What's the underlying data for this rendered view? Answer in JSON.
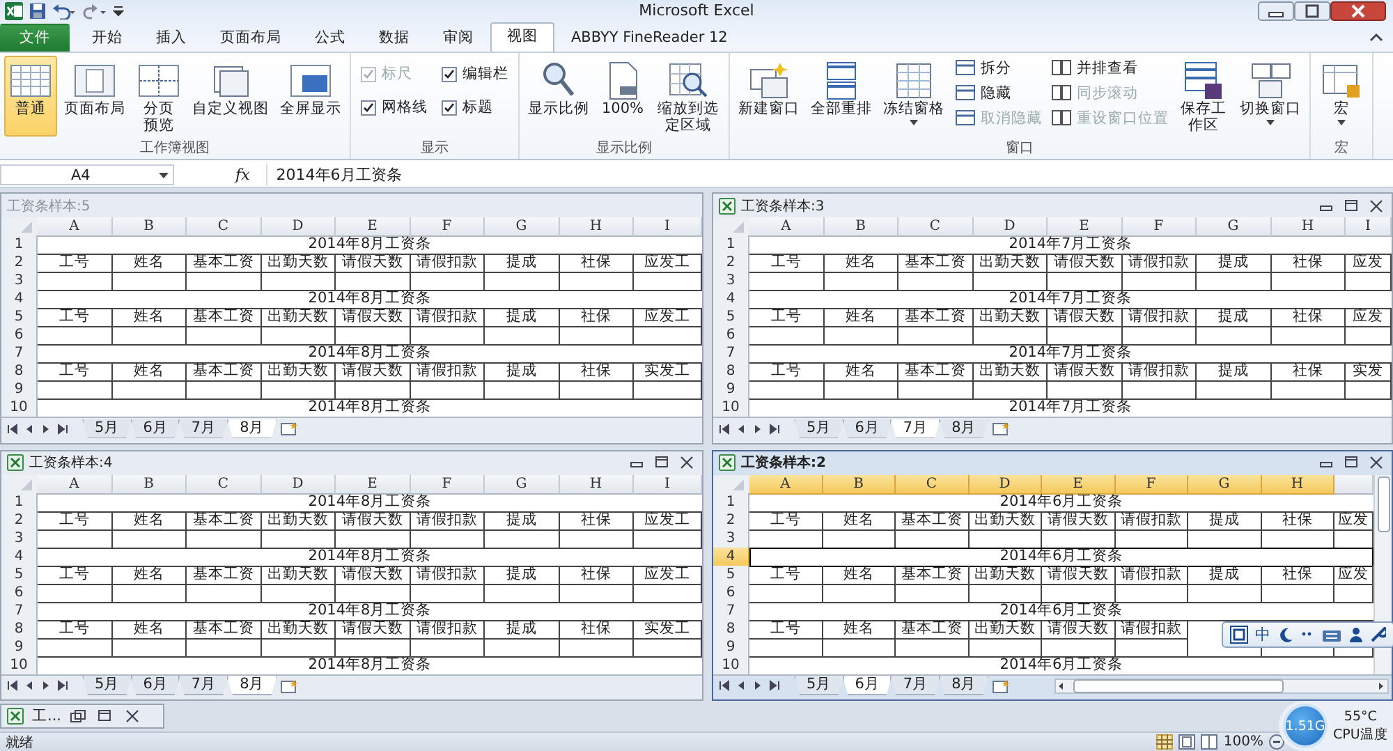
{
  "title_bar": {
    "title": "Microsoft Excel"
  },
  "tabs": [
    {
      "label": "文件",
      "kind": "file",
      "selected": false
    },
    {
      "label": "开始",
      "kind": "tab",
      "selected": false
    },
    {
      "label": "插入",
      "kind": "tab",
      "selected": false
    },
    {
      "label": "页面布局",
      "kind": "tab",
      "selected": false
    },
    {
      "label": "公式",
      "kind": "tab",
      "selected": false
    },
    {
      "label": "数据",
      "kind": "tab",
      "selected": false
    },
    {
      "label": "审阅",
      "kind": "tab",
      "selected": false
    },
    {
      "label": "视图",
      "kind": "tab",
      "selected": true
    },
    {
      "label": "ABBYY FineReader 12",
      "kind": "tab",
      "selected": false
    }
  ],
  "ribbon": {
    "groups": [
      {
        "label": "工作簿视图",
        "items": [
          {
            "kind": "large",
            "label": "普通",
            "selected": true
          },
          {
            "kind": "large",
            "label": "页面布局",
            "selected": false
          },
          {
            "kind": "large",
            "label": "分页预览",
            "wrap": true,
            "selected": false
          },
          {
            "kind": "large",
            "label": "自定义视图",
            "selected": false
          },
          {
            "kind": "large",
            "label": "全屏显示",
            "selected": false
          }
        ]
      },
      {
        "label": "显示",
        "items": [
          {
            "kind": "checkbox",
            "label": "标尺",
            "checked": true,
            "disabled": true
          },
          {
            "kind": "checkbox",
            "label": "编辑栏",
            "checked": true,
            "disabled": false
          },
          {
            "kind": "checkbox",
            "label": "网格线",
            "checked": true,
            "disabled": false
          },
          {
            "kind": "checkbox",
            "label": "标题",
            "checked": true,
            "disabled": false
          }
        ]
      },
      {
        "label": "显示比例",
        "items": [
          {
            "kind": "large",
            "label": "显示比例"
          },
          {
            "kind": "large",
            "label": "100%"
          },
          {
            "kind": "large",
            "label": "缩放到选定区域",
            "wrap": true
          }
        ]
      },
      {
        "label": "窗口",
        "items": [
          {
            "kind": "large",
            "label": "新建窗口"
          },
          {
            "kind": "large",
            "label": "全部重排"
          },
          {
            "kind": "large",
            "label": "冻结窗格",
            "dropdown": true
          },
          {
            "kind": "small",
            "label": "拆分",
            "disabled": false
          },
          {
            "kind": "small",
            "label": "隐藏",
            "disabled": false
          },
          {
            "kind": "small",
            "label": "取消隐藏",
            "disabled": true
          },
          {
            "kind": "small",
            "label": "并排查看",
            "disabled": false
          },
          {
            "kind": "small",
            "label": "同步滚动",
            "disabled": true
          },
          {
            "kind": "small",
            "label": "重设窗口位置",
            "disabled": true
          },
          {
            "kind": "large",
            "label": "保存工作区",
            "wrap": true
          },
          {
            "kind": "large",
            "label": "切换窗口",
            "dropdown": true
          }
        ]
      },
      {
        "label": "宏",
        "items": [
          {
            "kind": "large",
            "label": "宏",
            "dropdown": true
          }
        ]
      }
    ]
  },
  "formula_bar": {
    "cell": "A4",
    "function_symbol": "fx",
    "content": "2014年6月工资条"
  },
  "windows": [
    {
      "title": "工资条样本:5",
      "controls": false,
      "active": false,
      "columns": [
        {
          "label": "A",
          "selected": false
        },
        {
          "label": "B",
          "selected": false
        },
        {
          "label": "C",
          "selected": false
        },
        {
          "label": "D",
          "selected": false
        },
        {
          "label": "E",
          "selected": false
        },
        {
          "label": "F",
          "selected": false
        },
        {
          "label": "G",
          "selected": false
        },
        {
          "label": "H",
          "selected": false
        },
        {
          "label": "I",
          "selected": false
        }
      ],
      "rows": [
        {
          "number": "1",
          "kind": "title",
          "text": "2014年8月工资条",
          "selected": false
        },
        {
          "number": "2",
          "kind": "header",
          "cells": [
            "工号",
            "姓名",
            "基本工资",
            "出勤天数",
            "请假天数",
            "请假扣款",
            "提成",
            "社保",
            "应发工"
          ],
          "selected": false
        },
        {
          "number": "3",
          "kind": "blank",
          "selected": false
        },
        {
          "number": "4",
          "kind": "title",
          "text": "2014年8月工资条",
          "selected": false
        },
        {
          "number": "5",
          "kind": "header",
          "cells": [
            "工号",
            "姓名",
            "基本工资",
            "出勤天数",
            "请假天数",
            "请假扣款",
            "提成",
            "社保",
            "应发工"
          ],
          "selected": false
        },
        {
          "number": "6",
          "kind": "blank",
          "selected": false
        },
        {
          "number": "7",
          "kind": "title",
          "text": "2014年8月工资条",
          "selected": false
        },
        {
          "number": "8",
          "kind": "header",
          "cells": [
            "工号",
            "姓名",
            "基本工资",
            "出勤天数",
            "请假天数",
            "请假扣款",
            "提成",
            "社保",
            "实发工"
          ],
          "selected": false
        },
        {
          "number": "9",
          "kind": "blank",
          "selected": false
        },
        {
          "number": "10",
          "kind": "title",
          "text": "2014年8月工资条",
          "selected": false
        }
      ],
      "sheets": [
        {
          "label": "5月",
          "selected": false
        },
        {
          "label": "6月",
          "selected": false
        },
        {
          "label": "7月",
          "selected": false
        },
        {
          "label": "8月",
          "selected": true
        }
      ]
    },
    {
      "title": "工资条样本:3",
      "controls": true,
      "active": false,
      "columns": [
        {
          "label": "A",
          "selected": false
        },
        {
          "label": "B",
          "selected": false
        },
        {
          "label": "C",
          "selected": false
        },
        {
          "label": "D",
          "selected": false
        },
        {
          "label": "E",
          "selected": false
        },
        {
          "label": "F",
          "selected": false
        },
        {
          "label": "G",
          "selected": false
        },
        {
          "label": "H",
          "selected": false
        },
        {
          "label": "I",
          "selected": false
        }
      ],
      "rows": [
        {
          "number": "1",
          "kind": "title",
          "text": "2014年7月工资条",
          "selected": false
        },
        {
          "number": "2",
          "kind": "header",
          "cells": [
            "工号",
            "姓名",
            "基本工资",
            "出勤天数",
            "请假天数",
            "请假扣款",
            "提成",
            "社保",
            "应发"
          ],
          "selected": false
        },
        {
          "number": "3",
          "kind": "blank",
          "selected": false
        },
        {
          "number": "4",
          "kind": "title",
          "text": "2014年7月工资条",
          "selected": false
        },
        {
          "number": "5",
          "kind": "header",
          "cells": [
            "工号",
            "姓名",
            "基本工资",
            "出勤天数",
            "请假天数",
            "请假扣款",
            "提成",
            "社保",
            "应发"
          ],
          "selected": false
        },
        {
          "number": "6",
          "kind": "blank",
          "selected": false
        },
        {
          "number": "7",
          "kind": "title",
          "text": "2014年7月工资条",
          "selected": false
        },
        {
          "number": "8",
          "kind": "header",
          "cells": [
            "工号",
            "姓名",
            "基本工资",
            "出勤天数",
            "请假天数",
            "请假扣款",
            "提成",
            "社保",
            "实发"
          ],
          "selected": false
        },
        {
          "number": "9",
          "kind": "blank",
          "selected": false
        },
        {
          "number": "10",
          "kind": "title",
          "text": "2014年7月工资条",
          "selected": false
        }
      ],
      "sheets": [
        {
          "label": "5月",
          "selected": false
        },
        {
          "label": "6月",
          "selected": false
        },
        {
          "label": "7月",
          "selected": true
        },
        {
          "label": "8月",
          "selected": false
        }
      ]
    },
    {
      "title": "工资条样本:4",
      "controls": true,
      "active": false,
      "columns": [
        {
          "label": "A",
          "selected": false
        },
        {
          "label": "B",
          "selected": false
        },
        {
          "label": "C",
          "selected": false
        },
        {
          "label": "D",
          "selected": false
        },
        {
          "label": "E",
          "selected": false
        },
        {
          "label": "F",
          "selected": false
        },
        {
          "label": "G",
          "selected": false
        },
        {
          "label": "H",
          "selected": false
        },
        {
          "label": "I",
          "selected": false
        }
      ],
      "rows": [
        {
          "number": "1",
          "kind": "title",
          "text": "2014年8月工资条",
          "selected": false
        },
        {
          "number": "2",
          "kind": "header",
          "cells": [
            "工号",
            "姓名",
            "基本工资",
            "出勤天数",
            "请假天数",
            "请假扣款",
            "提成",
            "社保",
            "应发工"
          ],
          "selected": false
        },
        {
          "number": "3",
          "kind": "blank",
          "selected": false
        },
        {
          "number": "4",
          "kind": "title",
          "text": "2014年8月工资条",
          "selected": false
        },
        {
          "number": "5",
          "kind": "header",
          "cells": [
            "工号",
            "姓名",
            "基本工资",
            "出勤天数",
            "请假天数",
            "请假扣款",
            "提成",
            "社保",
            "应发工"
          ],
          "selected": false
        },
        {
          "number": "6",
          "kind": "blank",
          "selected": false
        },
        {
          "number": "7",
          "kind": "title",
          "text": "2014年8月工资条",
          "selected": false
        },
        {
          "number": "8",
          "kind": "header",
          "cells": [
            "工号",
            "姓名",
            "基本工资",
            "出勤天数",
            "请假天数",
            "请假扣款",
            "提成",
            "社保",
            "实发工"
          ],
          "selected": false
        },
        {
          "number": "9",
          "kind": "blank",
          "selected": false
        },
        {
          "number": "10",
          "kind": "title",
          "text": "2014年8月工资条",
          "selected": false
        }
      ],
      "sheets": [
        {
          "label": "5月",
          "selected": false
        },
        {
          "label": "6月",
          "selected": false
        },
        {
          "label": "7月",
          "selected": false
        },
        {
          "label": "8月",
          "selected": true
        }
      ]
    },
    {
      "title": "工资条样本:2",
      "controls": true,
      "active": true,
      "columns": [
        {
          "label": "A",
          "selected": true
        },
        {
          "label": "B",
          "selected": true
        },
        {
          "label": "C",
          "selected": true
        },
        {
          "label": "D",
          "selected": true
        },
        {
          "label": "E",
          "selected": true
        },
        {
          "label": "F",
          "selected": true
        },
        {
          "label": "G",
          "selected": true
        },
        {
          "label": "H",
          "selected": true
        }
      ],
      "rows": [
        {
          "number": "1",
          "kind": "title",
          "text": "2014年6月工资条",
          "selected": false
        },
        {
          "number": "2",
          "kind": "header",
          "cells": [
            "工号",
            "姓名",
            "基本工资",
            "出勤天数",
            "请假天数",
            "请假扣款",
            "提成",
            "社保",
            "应发"
          ],
          "selected": false
        },
        {
          "number": "3",
          "kind": "blank",
          "selected": false
        },
        {
          "number": "4",
          "kind": "title",
          "text": "2014年6月工资条",
          "selected": true
        },
        {
          "number": "5",
          "kind": "header",
          "cells": [
            "工号",
            "姓名",
            "基本工资",
            "出勤天数",
            "请假天数",
            "请假扣款",
            "提成",
            "社保",
            "应发"
          ],
          "selected": false
        },
        {
          "number": "6",
          "kind": "blank",
          "selected": false
        },
        {
          "number": "7",
          "kind": "title",
          "text": "2014年6月工资条",
          "selected": false
        },
        {
          "number": "8",
          "kind": "header",
          "cells": [
            "工号",
            "姓名",
            "基本工资",
            "出勤天数",
            "请假天数",
            "请假扣款"
          ],
          "selected": false
        },
        {
          "number": "9",
          "kind": "blank",
          "selected": false
        },
        {
          "number": "10",
          "kind": "title",
          "text": "2014年6月工资条",
          "selected": false
        }
      ],
      "sheets": [
        {
          "label": "5月",
          "selected": false
        },
        {
          "label": "6月",
          "selected": true
        },
        {
          "label": "7月",
          "selected": false
        },
        {
          "label": "8月",
          "selected": false
        }
      ]
    }
  ],
  "ime_toolbar": {
    "mode": "中"
  },
  "minimized_window": {
    "title": "工..."
  },
  "status_bar": {
    "status": "就绪",
    "zoom": "100%"
  },
  "cpu_widget": {
    "memory": "1.51G",
    "temperature": "55°C",
    "label": "CPU温度"
  }
}
